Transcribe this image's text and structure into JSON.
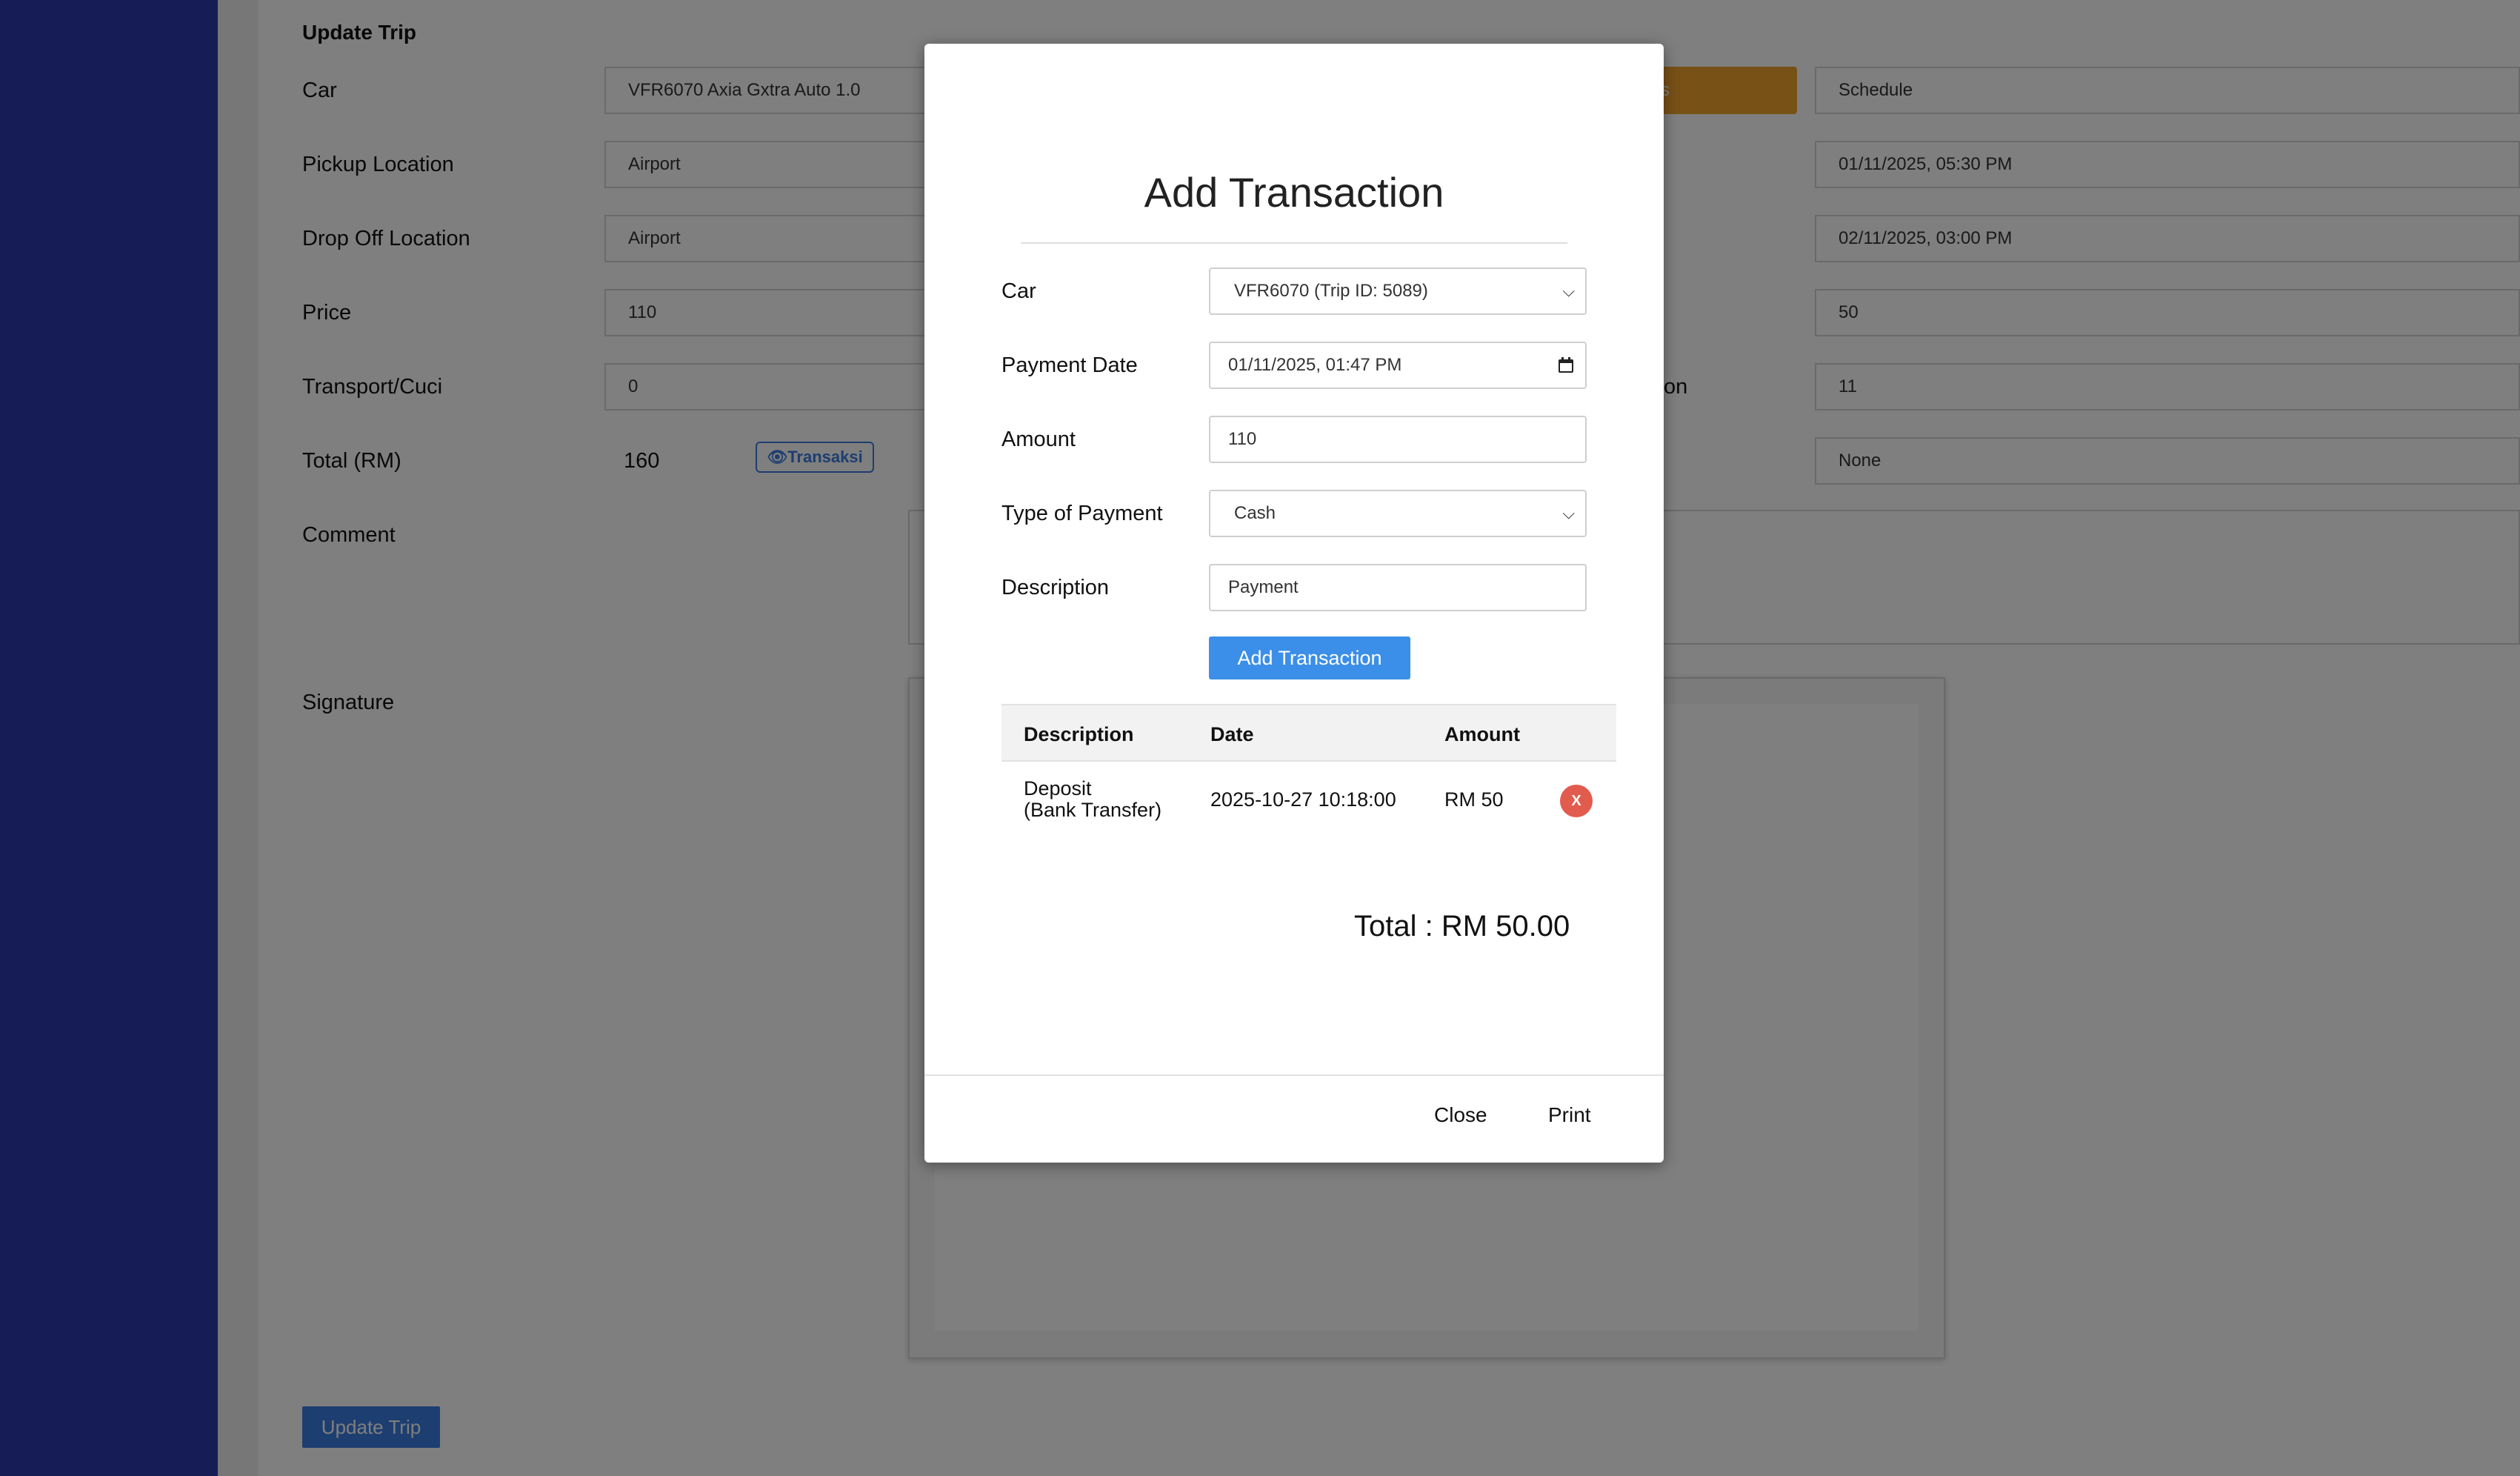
{
  "form": {
    "section_title": "Update Trip",
    "car": {
      "label": "Car",
      "value": "VFR6070 Axia Gxtra Auto 1.0"
    },
    "pickup": {
      "label": "Pickup Location",
      "value": "Airport"
    },
    "dropoff": {
      "label": "Drop Off Location",
      "value": "Airport"
    },
    "price": {
      "label": "Price",
      "value": "110"
    },
    "transport": {
      "label": "Transport/Cuci",
      "value": "0"
    },
    "total": {
      "label": "Total (RM)",
      "value": "160"
    },
    "transaksi_label": "Transaksi",
    "comment_label": "Comment",
    "signature_label": "Signature",
    "orange_button_fragment": "s",
    "right_column": {
      "status": "Schedule",
      "pickup_datetime": "01/11/2025, 05:30 PM",
      "dropoff_datetime": "02/11/2025, 03:00 PM",
      "deposit": "50",
      "field_5_label_fragment": "on",
      "field_5_value": "11",
      "field_6_value": "None"
    },
    "update_button": "Update Trip"
  },
  "modal": {
    "title": "Add Transaction",
    "fields": {
      "car": {
        "label": "Car",
        "value": "VFR6070 (Trip ID: 5089)"
      },
      "payment_date": {
        "label": "Payment Date",
        "value": "01/11/2025, 01:47 PM"
      },
      "amount": {
        "label": "Amount",
        "value": "110"
      },
      "payment_type": {
        "label": "Type of Payment",
        "value": "Cash"
      },
      "description": {
        "label": "Description",
        "value": "Payment"
      }
    },
    "add_button": "Add Transaction",
    "table": {
      "headers": [
        "Description",
        "Date",
        "Amount"
      ],
      "rows": [
        {
          "description_line1": "Deposit",
          "description_line2": "(Bank Transfer)",
          "date": "2025-10-27 10:18:00",
          "amount": "RM 50",
          "delete": "X"
        }
      ]
    },
    "total": "Total : RM 50.00",
    "close_button": "Close",
    "print_button": "Print"
  },
  "colors": {
    "sidebar": "#2d3aad",
    "primary": "#3b8fe8",
    "warning": "#f0a22e",
    "danger": "#e25b4f"
  }
}
